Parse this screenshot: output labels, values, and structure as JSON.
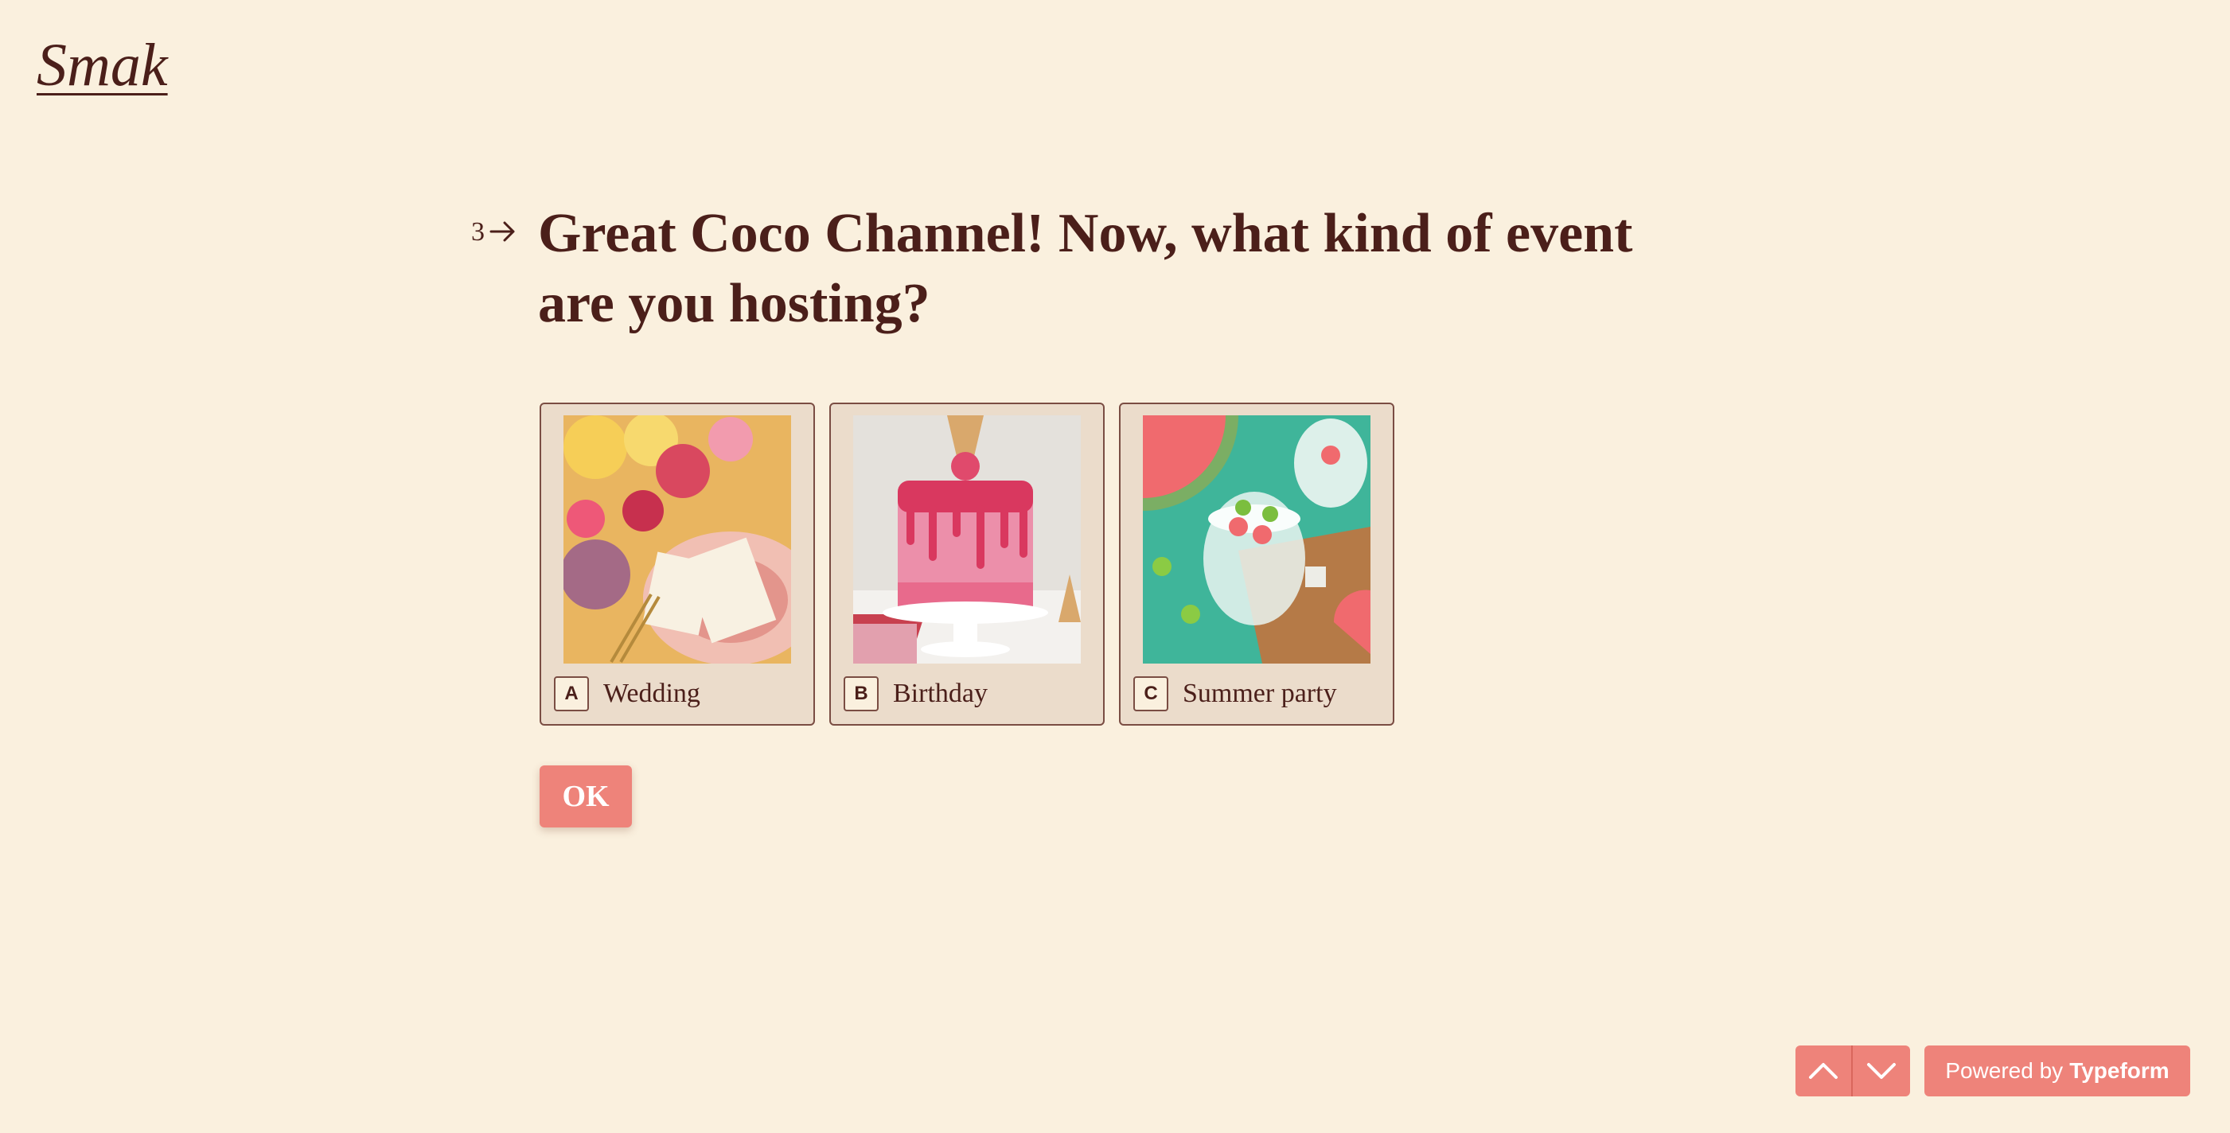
{
  "brand": {
    "logo_text": "Smak"
  },
  "question": {
    "number": "3",
    "arrow_icon": "arrow-right-icon",
    "text": "Great Coco Channel! Now, what kind of event are you hosting?"
  },
  "choices": [
    {
      "key": "A",
      "label": "Wedding",
      "image": "wedding-table-flowers-image"
    },
    {
      "key": "B",
      "label": "Birthday",
      "image": "pink-drip-birthday-cake-image"
    },
    {
      "key": "C",
      "label": "Summer party",
      "image": "watermelon-drinks-image"
    }
  ],
  "ok_button": {
    "label": "OK"
  },
  "footer": {
    "up_icon": "chevron-up-icon",
    "down_icon": "chevron-down-icon",
    "powered_prefix": "Powered by",
    "powered_brand": "Typeform"
  },
  "colors": {
    "background": "#FAF0DE",
    "text": "#4B1F1A",
    "accent": "#EE837A",
    "card": "#EBDCCB"
  }
}
